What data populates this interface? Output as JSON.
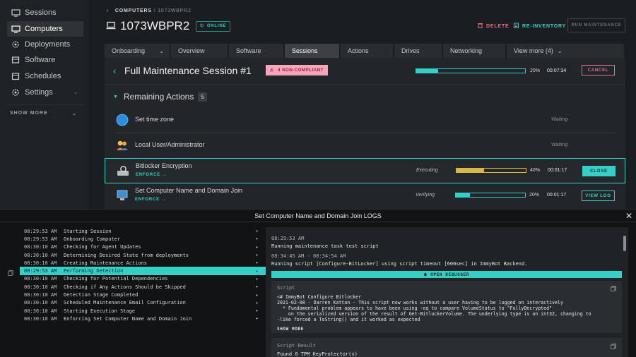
{
  "colors": {
    "accent": "#35cfc8",
    "danger": "#ef6b8f",
    "warning_bar": "#d9b64a",
    "background": "#1b1e20"
  },
  "sidebar": {
    "items": [
      {
        "label": "Sessions",
        "icon": "monitor-icon"
      },
      {
        "label": "Computers",
        "icon": "monitor-icon",
        "active": true
      },
      {
        "label": "Deployments",
        "icon": "gear-icon"
      },
      {
        "label": "Software",
        "icon": "package-icon"
      },
      {
        "label": "Schedules",
        "icon": "calendar-icon"
      },
      {
        "label": "Settings",
        "icon": "gear-icon"
      }
    ],
    "show_more": "SHOW MORE"
  },
  "header": {
    "breadcrumb_root": "COMPUTERS",
    "breadcrumb_sub": "/ 1073WBPR2",
    "computer_name": "1073WBPR2",
    "status": "ONLINE",
    "delete_label": "DELETE",
    "reinventory_label": "RE-INVENTORY",
    "run_maintenance_label": "RUN MAINTENANCE"
  },
  "tabs": [
    {
      "label": "Onboarding",
      "dropdown": true
    },
    {
      "label": "Overview"
    },
    {
      "label": "Software"
    },
    {
      "label": "Sessions",
      "active": true
    },
    {
      "label": "Actions"
    },
    {
      "label": "Drives"
    },
    {
      "label": "Networking"
    },
    {
      "label": "View more (4)",
      "dropdown": true
    }
  ],
  "session": {
    "title": "Full Maintenance Session #1",
    "noncompliant_badge": "4 NON-COMPLIANT",
    "progress": 0.2,
    "progress_label": "20%",
    "elapsed": "00:07:34",
    "cancel_label": "CANCEL",
    "remaining_label": "Remaining Actions",
    "remaining_count": "5"
  },
  "actions": [
    {
      "name": "Set time zone",
      "status": "Waiting",
      "icon": "globe-icon"
    },
    {
      "name": "Local User/Administrator",
      "status": "Waiting",
      "icon": "users-icon"
    },
    {
      "name": "Bitlocker Encryption",
      "enforce": "ENFORCE →",
      "status": "Executing",
      "progress": 0.4,
      "progress_label": "40%",
      "time": "00:01:17",
      "button": "CLOSE",
      "icon": "drive-lock-icon"
    },
    {
      "name": "Set Computer Name and Domain Join",
      "enforce": "ENFORCE →",
      "status": "Verifying",
      "progress": 0.2,
      "progress_label": "20%",
      "time": "00:01:17",
      "button": "VIEW LOG",
      "icon": "computer-network-icon"
    }
  ],
  "logs": {
    "title": "Set Computer Name and Domain Join LOGS",
    "entries": [
      {
        "time": "08:29:53 AM",
        "message": "Starting Session"
      },
      {
        "time": "08:29:53 AM",
        "message": "Onboarding Computer"
      },
      {
        "time": "08:30:10 AM",
        "message": "Checking for Agent Updates"
      },
      {
        "time": "08:30:10 AM",
        "message": "Determining Desired State from deployments"
      },
      {
        "time": "08:30:10 AM",
        "message": "Creating Maintenance Actions"
      },
      {
        "time": "08:29:53 AM",
        "message": "Performing Detection",
        "selected": true
      },
      {
        "time": "08:30:10 AM",
        "message": "Checking for Potential Dependencies"
      },
      {
        "time": "08:30:10 AM",
        "message": "Checking if Any Actions Should be Skipped"
      },
      {
        "time": "08:30:10 AM",
        "message": "Detection Stage Completed"
      },
      {
        "time": "08:30:10 AM",
        "message": "Scheduled Maintenance Email Configuration"
      },
      {
        "time": "08:30:10 AM",
        "message": "Starting Execution Stage"
      },
      {
        "time": "08:30:10 AM",
        "message": "Enforcing Set Computer Name and Domain Join"
      }
    ],
    "detail": {
      "time1": "08:29:53 AM",
      "text1": "Running maintenance task test script",
      "time2": "08:34:45 AM - 08:34:54 AM",
      "text2": "Running script [Configure-BitLocker] using script timeout [600sec] in ImmyBot Backend.",
      "open_debugger": "OPEN DEBUGGER",
      "script_label": "Script",
      "script_lines": [
        "<# ImmyBot Configure Bitlocker",
        "2021-02-08 - Darren Kattan - This script now works without a user having to be logged on interactively",
        "  * Fundamental problem appears to have been using -eq to compare VolumeStatus to \"FullyDecrypted\"",
        "    on the serialized version of the result of Get-BitlockerVolume. The underlying type is an int32, changing to",
        "-like forced a ToString() and it worked as expected"
      ],
      "show_more": "SHOW MORE",
      "result_label": "Script Result",
      "result_text": "Found 0 TPM KeyProtector(s)"
    }
  }
}
